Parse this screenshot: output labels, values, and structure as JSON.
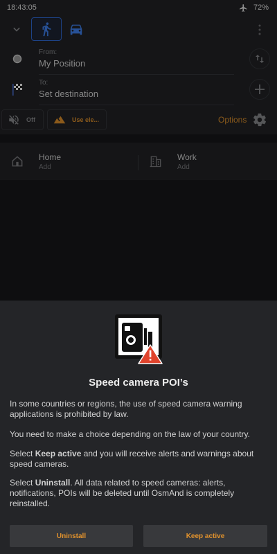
{
  "status_bar": {
    "time": "18:43:05",
    "battery": "72%"
  },
  "route": {
    "from_label": "From:",
    "from_value": "My Position",
    "to_label": "To:",
    "to_value": "Set destination"
  },
  "toggles": {
    "sound_label": "Off",
    "elevation_label": "Use ele...",
    "options_label": "Options"
  },
  "favorites": [
    {
      "title": "Home",
      "subtitle": "Add"
    },
    {
      "title": "Work",
      "subtitle": "Add"
    }
  ],
  "dialog": {
    "title": "Speed camera POI’s",
    "para1": "In some countries or regions, the use of speed camera warning applications is prohibited by law.",
    "para2": "You need to make a choice depending on the law of your country.",
    "para3_prefix": "Select ",
    "para3_bold": "Keep active",
    "para3_suffix": " and you will receive alerts and warnings about speed cameras.",
    "para4_prefix": "Select ",
    "para4_bold": "Uninstall",
    "para4_suffix": ". All data related to speed cameras: alerts, notifications, POIs will be deleted until OsmAnd is completely reinstalled.",
    "uninstall_label": "Uninstall",
    "keep_label": "Keep active"
  },
  "colors": {
    "accent": "#e1922d",
    "active_mode": "#2f6bd9",
    "warning": "#e0432c"
  }
}
